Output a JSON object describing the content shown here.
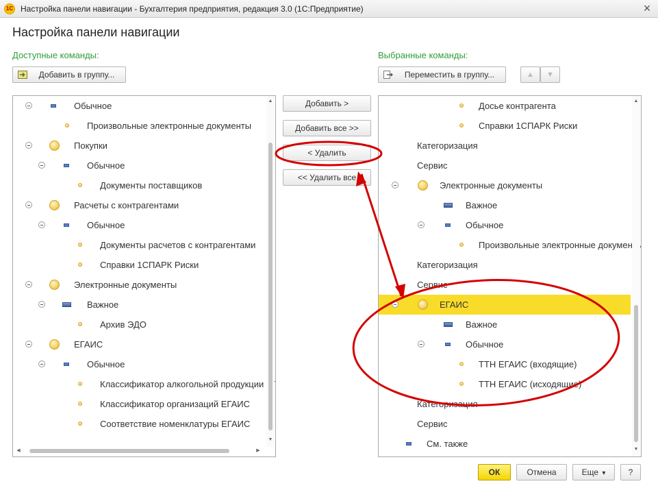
{
  "window": {
    "logo_text": "1С",
    "title": "Настройка панели навигации - Бухгалтерия предприятия, редакция 3.0  (1С:Предприятие)",
    "close_glyph": "×"
  },
  "form_title": "Настройка панели навигации",
  "available": {
    "label": "Доступные команды:",
    "add_to_group": "Добавить в группу...",
    "items": [
      {
        "text": "Обычное",
        "icon": "dash",
        "expander": true,
        "level": 1
      },
      {
        "text": "Произвольные электронные документы",
        "icon": "dot",
        "expander": false,
        "level": 2
      },
      {
        "text": "Покупки",
        "icon": "big",
        "expander": true,
        "level": 1
      },
      {
        "text": "Обычное",
        "icon": "dash",
        "expander": true,
        "level": 2
      },
      {
        "text": "Документы поставщиков",
        "icon": "dot",
        "expander": false,
        "level": 3
      },
      {
        "text": "Расчеты с контрагентами",
        "icon": "big",
        "expander": true,
        "level": 1
      },
      {
        "text": "Обычное",
        "icon": "dash",
        "expander": true,
        "level": 2
      },
      {
        "text": "Документы расчетов с контрагентами",
        "icon": "dot",
        "expander": false,
        "level": 3
      },
      {
        "text": "Справки 1СПАРК Риски",
        "icon": "dot",
        "expander": false,
        "level": 3
      },
      {
        "text": "Электронные документы",
        "icon": "big",
        "expander": true,
        "level": 1
      },
      {
        "text": "Важное",
        "icon": "rect",
        "expander": true,
        "level": 2
      },
      {
        "text": "Архив ЭДО",
        "icon": "dot",
        "expander": false,
        "level": 3
      },
      {
        "text": "ЕГАИС",
        "icon": "big",
        "expander": true,
        "level": 1
      },
      {
        "text": "Обычное",
        "icon": "dash",
        "expander": true,
        "level": 2
      },
      {
        "text": "Классификатор алкогольной продукции ЕГАИС",
        "icon": "dot",
        "expander": false,
        "level": 3
      },
      {
        "text": "Классификатор организаций ЕГАИС",
        "icon": "dot",
        "expander": false,
        "level": 3
      },
      {
        "text": "Соответствие номенклатуры ЕГАИС",
        "icon": "dot",
        "expander": false,
        "level": 3
      }
    ]
  },
  "middle_buttons": {
    "add": "Добавить >",
    "add_all": "Добавить все >>",
    "remove": "< Удалить",
    "remove_all": "<< Удалить все"
  },
  "selected": {
    "label": "Выбранные команды:",
    "move_to_group": "Переместить в группу...",
    "up_glyph": "▲",
    "down_glyph": "▼",
    "items": [
      {
        "text": "Досье контрагента",
        "icon": "dot",
        "expander": false,
        "level": 4
      },
      {
        "text": "Справки 1СПАРК Риски",
        "icon": "dot",
        "expander": false,
        "level": 4
      },
      {
        "text": "Категоризация",
        "icon": "none",
        "expander": false,
        "level": 2
      },
      {
        "text": "Сервис",
        "icon": "none",
        "expander": false,
        "level": 2
      },
      {
        "text": "Электронные документы",
        "icon": "big",
        "expander": true,
        "level": 1
      },
      {
        "text": "Важное",
        "icon": "rect",
        "expander": false,
        "level": 3
      },
      {
        "text": "Обычное",
        "icon": "dash",
        "expander": true,
        "level": 3
      },
      {
        "text": "Произвольные электронные документы",
        "icon": "dot",
        "expander": false,
        "level": 4
      },
      {
        "text": "Категоризация",
        "icon": "none",
        "expander": false,
        "level": 2
      },
      {
        "text": "Сервис",
        "icon": "none",
        "expander": false,
        "level": 2
      },
      {
        "text": "ЕГАИС",
        "icon": "big",
        "expander": true,
        "level": 1,
        "selected": true
      },
      {
        "text": "Важное",
        "icon": "rect",
        "expander": false,
        "level": 3
      },
      {
        "text": "Обычное",
        "icon": "dash",
        "expander": true,
        "level": 3
      },
      {
        "text": "ТТН ЕГАИС (входящие)",
        "icon": "dot",
        "expander": false,
        "level": 4
      },
      {
        "text": "ТТН ЕГАИС (исходящие)",
        "icon": "dot",
        "expander": false,
        "level": 4
      },
      {
        "text": "Категоризация",
        "icon": "none",
        "expander": false,
        "level": 2
      },
      {
        "text": "Сервис",
        "icon": "none",
        "expander": false,
        "level": 2
      },
      {
        "text": "См. также",
        "icon": "dash",
        "expander": false,
        "level": 0
      }
    ]
  },
  "footer": {
    "ok": "ОК",
    "cancel": "Отмена",
    "more": "Еще",
    "more_arrow": "▾",
    "help": "?"
  },
  "annotation_color": "#d40000",
  "selection_color": "#f9dc2a"
}
